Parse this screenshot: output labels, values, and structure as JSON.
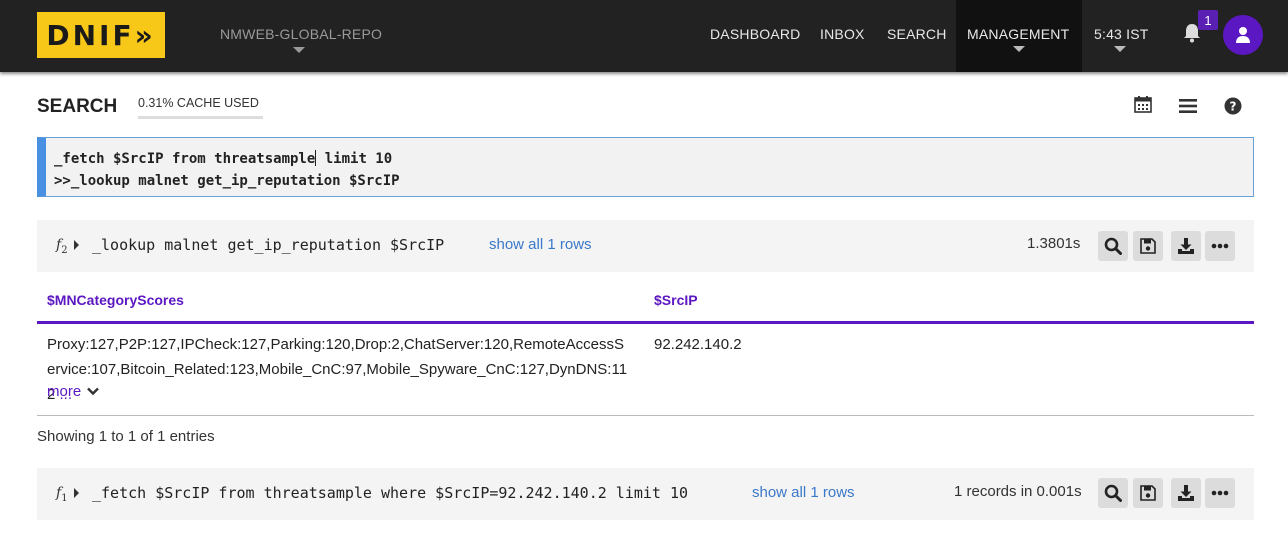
{
  "navbar": {
    "logo_text": "DNIF»",
    "repo": "NMWEB-GLOBAL-REPO",
    "items": [
      "DASHBOARD",
      "INBOX",
      "SEARCH",
      "MANAGEMENT"
    ],
    "time": "5:43 IST",
    "notification_count": "1",
    "accent": "#5b17c2"
  },
  "search": {
    "title": "SEARCH",
    "cache": "0.31% CACHE USED",
    "query_line1_a": "_fetch $SrcIP from threatsample",
    "query_line1_b": " limit 10",
    "query_line2": ">>_lookup malnet get_ip_reputation $SrcIP"
  },
  "results": [
    {
      "fn": "f",
      "index": "2",
      "query": "_lookup malnet get_ip_reputation $SrcIP",
      "show_all": "show all 1 rows",
      "timing": "1.3801s"
    },
    {
      "fn": "f",
      "index": "1",
      "query": "_fetch $SrcIP from threatsample where $SrcIP=92.242.140.2 limit 10",
      "show_all": "show all 1 rows",
      "timing": "1 records in 0.001s"
    }
  ],
  "table": {
    "headers": [
      "$MNCategoryScores",
      "$SrcIP"
    ],
    "row": {
      "scores": "Proxy:127,P2P:127,IPCheck:127,Parking:120,Drop:2,ChatServer:120,RemoteAccessService:107,Bitcoin_Related:123,Mobile_CnC:97,Mobile_Spyware_CnC:127,DynDNS:112",
      "ellipsis": " ...",
      "more": "more",
      "ip": "92.242.140.2"
    },
    "showing": "Showing 1 to 1 of 1 entries"
  }
}
